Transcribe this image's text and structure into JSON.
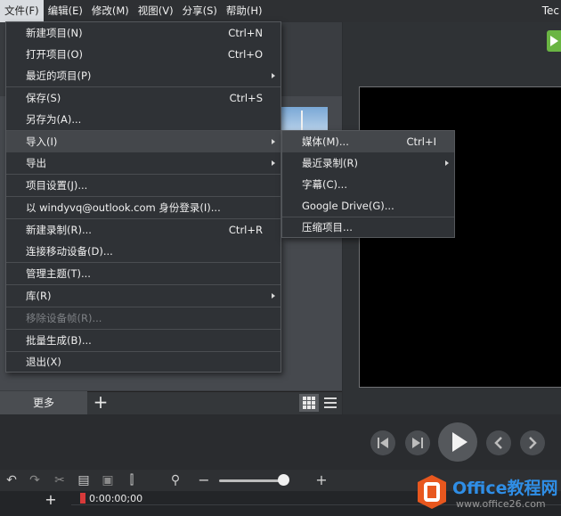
{
  "menubar": {
    "items": [
      "文件(F)",
      "编辑(E)",
      "修改(M)",
      "视图(V)",
      "分享(S)",
      "帮助(H)"
    ],
    "brand": "Tec"
  },
  "file_menu": {
    "items": [
      {
        "label": "新建项目(N)",
        "shortcut": "Ctrl+N"
      },
      {
        "label": "打开项目(O)",
        "shortcut": "Ctrl+O"
      },
      {
        "label": "最近的项目(P)",
        "submenu": true
      },
      {
        "label": "保存(S)",
        "shortcut": "Ctrl+S"
      },
      {
        "label": "另存为(A)..."
      },
      {
        "label": "导入(I)",
        "submenu": true,
        "highlighted": true
      },
      {
        "label": "导出",
        "submenu": true
      },
      {
        "label": "项目设置(J)..."
      },
      {
        "label": "以 windyvq@outlook.com 身份登录(I)..."
      },
      {
        "label": "新建录制(R)...",
        "shortcut": "Ctrl+R"
      },
      {
        "label": "连接移动设备(D)..."
      },
      {
        "label": "管理主题(T)..."
      },
      {
        "label": "库(R)",
        "submenu": true
      },
      {
        "label": "移除设备帧(R)...",
        "disabled": true
      },
      {
        "label": "批量生成(B)..."
      },
      {
        "label": "退出(X)"
      }
    ]
  },
  "import_menu": {
    "items": [
      {
        "label": "媒体(M)...",
        "shortcut": "Ctrl+I"
      },
      {
        "label": "最近录制(R)",
        "submenu": true
      },
      {
        "label": "字幕(C)..."
      },
      {
        "label": "Google Drive(G)..."
      },
      {
        "label": "压缩项目..."
      }
    ]
  },
  "bottom": {
    "more_label": "更多",
    "plus_label": "+",
    "timecode": "0:00:00;00"
  },
  "watermark": {
    "title": "Office教程网",
    "url": "www.office26.com"
  },
  "colors": {
    "accent_green": "#6ab543",
    "watermark_orange": "#e8571e",
    "watermark_blue": "#2f8ee6"
  }
}
